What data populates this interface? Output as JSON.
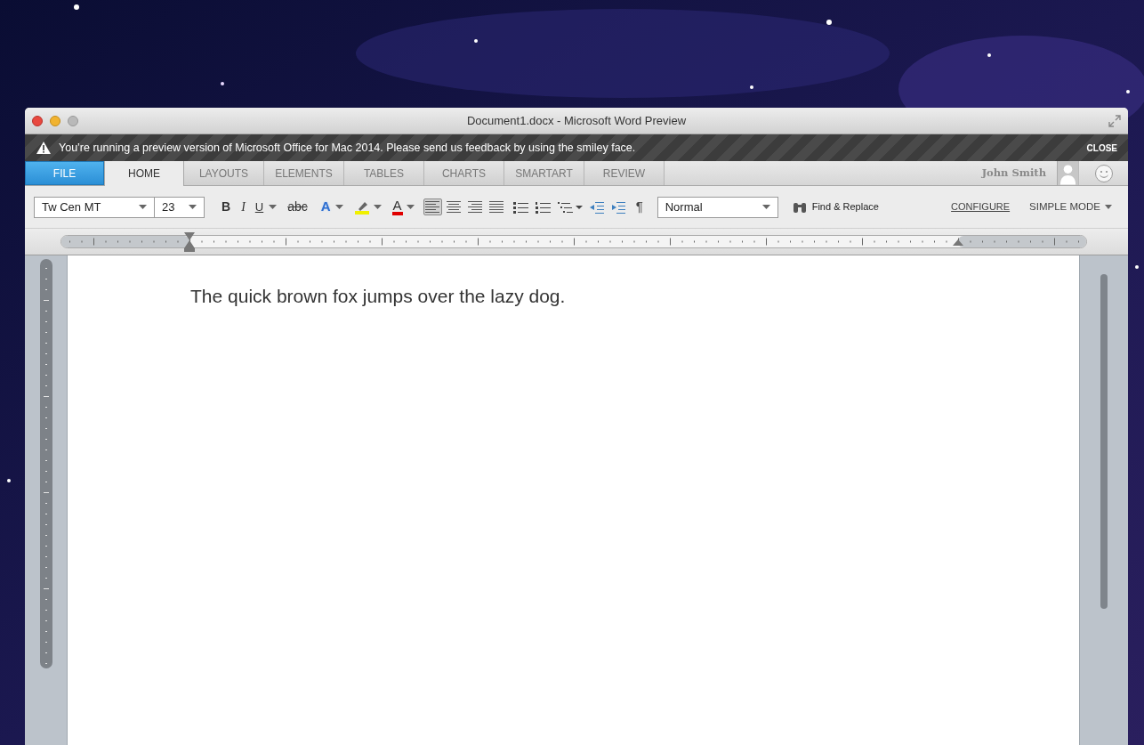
{
  "window": {
    "title": "Document1.docx - Microsoft Word Preview"
  },
  "banner": {
    "message": "You’re running a preview version of Microsoft Office for Mac 2014. Please send us feedback by using the smiley face.",
    "close": "CLOSE"
  },
  "tabs": [
    {
      "label": "FILE",
      "kind": "file",
      "selected": false
    },
    {
      "label": "HOME",
      "kind": "tab",
      "selected": true
    },
    {
      "label": "LAYOUTS",
      "kind": "tab",
      "selected": false
    },
    {
      "label": "ELEMENTS",
      "kind": "tab",
      "selected": false
    },
    {
      "label": "TABLES",
      "kind": "tab",
      "selected": false
    },
    {
      "label": "CHARTS",
      "kind": "tab",
      "selected": false
    },
    {
      "label": "SMARTART",
      "kind": "tab",
      "selected": false
    },
    {
      "label": "REVIEW",
      "kind": "tab",
      "selected": false
    }
  ],
  "user": {
    "name": "John Smith"
  },
  "toolbar": {
    "font": "Tw Cen MT",
    "size": "23",
    "format_buttons": [
      {
        "label": "B",
        "kind": "bold"
      },
      {
        "label": "I",
        "kind": "italic"
      },
      {
        "label": "U",
        "kind": "underline"
      },
      {
        "label": "abc",
        "kind": "strike"
      },
      {
        "label": "A",
        "kind": "effects"
      },
      {
        "kind": "highlight"
      },
      {
        "label": "A",
        "kind": "color"
      }
    ],
    "alignments": [
      {
        "kind": "left",
        "selected": true
      },
      {
        "kind": "center",
        "selected": false
      },
      {
        "kind": "right",
        "selected": false
      },
      {
        "kind": "justify",
        "selected": false
      }
    ],
    "paragraph_mark": "¶",
    "style": "Normal",
    "find": "Find & Replace",
    "configure": "CONFIGURE",
    "mode": "SIMPLE MODE"
  },
  "document": {
    "text": "The quick brown fox jumps over the lazy dog."
  }
}
